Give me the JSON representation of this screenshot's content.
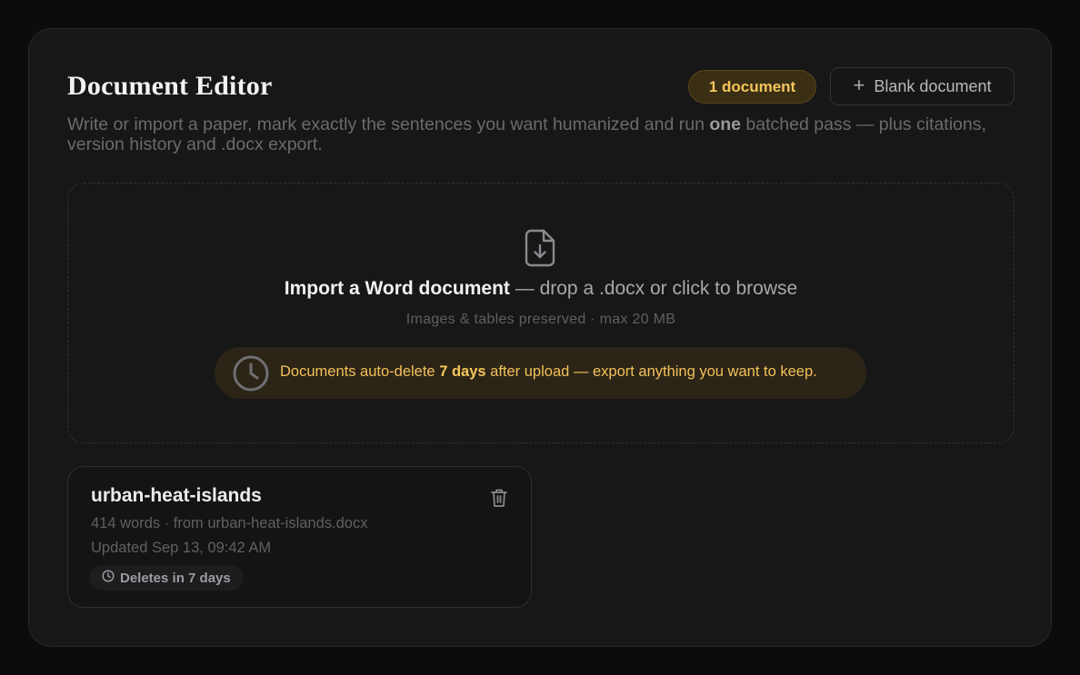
{
  "header": {
    "title": "Document Editor",
    "count_badge": "1 document",
    "blank_button": "Blank document",
    "subtitle_before": "Write or import a paper, mark exactly the sentences you want humanized and run ",
    "subtitle_bold": "one",
    "subtitle_after": " batched pass — plus citations, version history and .docx export."
  },
  "dropzone": {
    "icon": "file-download-icon",
    "import_bold": "Import a Word document",
    "import_rest": " — drop a .docx or click to browse",
    "hint": "Images & tables preserved · max 20 MB",
    "notice_before": "Documents auto-delete ",
    "notice_bold": "7 days",
    "notice_after": " after upload — export anything you want to keep."
  },
  "documents": [
    {
      "title": "urban-heat-islands",
      "meta": "414 words · from urban-heat-islands.docx",
      "updated": "Updated Sep 13, 09:42 AM",
      "delete_badge": "Deletes in 7 days"
    }
  ],
  "colors": {
    "accent": "#f4c55c",
    "background": "#0c0c0d",
    "panel": "#171718"
  }
}
